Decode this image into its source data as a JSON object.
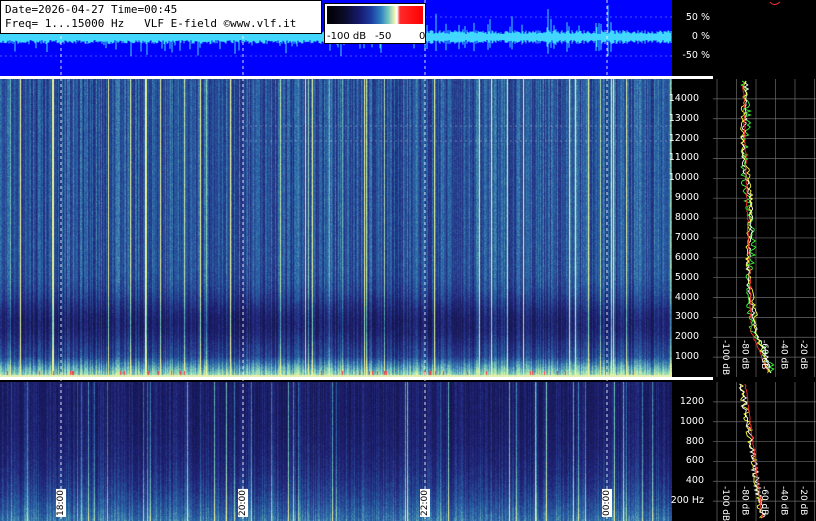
{
  "header": {
    "date_time": "Date=2026-04-27 Time=00:45",
    "freq_range": "Freq= 1...15000 Hz",
    "source": "VLF E-field ©www.vlf.it"
  },
  "color_scale": {
    "labels": [
      "-100 dB",
      "-50",
      "0"
    ],
    "colors": {
      "low": "#000000",
      "mid": "#1c3da0",
      "high": "#ffffff",
      "peak": "#ff0000"
    }
  },
  "waveform_panel": {
    "background": "#0000ff",
    "trace_color": "#3fd8ff",
    "y_ticks": [
      "50 %",
      "0 %",
      "-50 %"
    ]
  },
  "spectrogram_main": {
    "y_ticks": [
      "14000",
      "13000",
      "12000",
      "11000",
      "10000",
      "9000",
      "8000",
      "7000",
      "6000",
      "5000",
      "4000",
      "3000",
      "2000",
      "1000"
    ],
    "db_ticks": [
      "-100 dB",
      "-80 dB",
      "-60 dB",
      "-40 dB",
      "-20 dB"
    ]
  },
  "spectrogram_low": {
    "y_ticks": [
      "1200",
      "1000",
      "800",
      "600",
      "400",
      "200 Hz"
    ],
    "db_ticks": [
      "-100 dB",
      "-80 dB",
      "-60 dB",
      "-40 dB",
      "-20 dB"
    ]
  },
  "time_axis": {
    "labels": [
      "18:00",
      "20:00",
      "22:00",
      "00:00"
    ],
    "positions_fraction": [
      0.091,
      0.362,
      0.633,
      0.904
    ]
  }
}
